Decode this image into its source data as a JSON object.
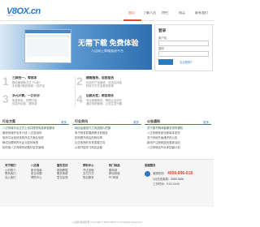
{
  "header": {
    "logo": "V8OX.cn",
    "logo_sub": "V8OX",
    "nav": [
      "首页",
      "了解八达",
      "特色",
      "购买",
      "联系我们"
    ],
    "nav_active": 0
  },
  "banner": {
    "headline": "无需下载  免费体验",
    "tagline": "八达网上商城管理平台"
  },
  "login": {
    "title": "登录",
    "username_label": "用户名",
    "password_label": "密码",
    "button": "登录",
    "forgot": "忘记密码？"
  },
  "features": [
    {
      "num": "1",
      "title": "三网合一，零成本",
      "desc1": "移动营销新方式 PC版+",
      "desc2": "手机版+微信商城 一站开店"
    },
    {
      "num": "2",
      "title": "随需服务，自由组合",
      "desc1": "包括开户及维修，包括支持各",
      "desc2": "种支付方式及物流查询"
    },
    {
      "num": "3",
      "title": "多元计费，一口价计",
      "desc1": "免费体验，按需付费",
      "desc2": "包括开店费，服务费"
    },
    {
      "num": "4",
      "title": "后顾无忧，帮您成长",
      "desc1": "专业客服服务，帮助企业成长",
      "desc2": "通过系统营销，让您生意兴隆"
    }
  ],
  "news_cols": [
    {
      "title": "行业方案",
      "more": "更多",
      "items": [
        "八达商城平台正式上线并提供免费体验服务",
        "微信商城开店多少钱 八达告诉你",
        "电商平台如何选择开店方案比较好",
        "移动互联网时代企业如何转型",
        "如何用八达商城系统做好会员营销"
      ]
    },
    {
      "title": "行业资讯",
      "more": "更多",
      "items": [
        "网店运营技巧之商品图片拍摄",
        "电子商务发展趋势分析报告",
        "如何提升网店的转化率",
        "社交电商的未来发展方向",
        "从零开始学习网店运营"
      ]
    },
    {
      "title": "公告通知",
      "more": "更多",
      "items": [
        "关于春节期间客服安排的通知",
        "八达商城系统全新版本发布",
        "关于系统升级维护的公告",
        "新用户注册即送优惠券活动",
        "八达商城合作伙伴招募计划"
      ]
    }
  ],
  "footer_cols": [
    {
      "title": "关于我们",
      "items": [
        "公司简介",
        "联系我们",
        "加入我们"
      ]
    },
    {
      "title": "八达通",
      "items": [
        "新手指南",
        "常见问题",
        "帮助中心"
      ]
    },
    {
      "title": "服务支持",
      "items": [
        "使用教程",
        "服务条款",
        "意见反馈"
      ]
    },
    {
      "title": "帮助中心",
      "items": [
        "开店流程",
        "支付方式",
        "售后服务"
      ]
    },
    {
      "title": "热门商品",
      "items": [
        "微商城",
        "移动商城",
        "PC商城"
      ]
    }
  ],
  "contact": {
    "title": "客服服务",
    "label": "客服热线：",
    "phone": "4008-896-618",
    "qq": "QQ在线客服：8888 6666",
    "hours": "工作时间：9:00-18:00"
  },
  "copyright": "八达网 版权所有 Copyright © 2014 V8OX.cn All Rights Reserved",
  "colors": {
    "accent": "#2b78c7",
    "banner_bg": "#3a7cc0",
    "nav_active": "#e24c27"
  }
}
